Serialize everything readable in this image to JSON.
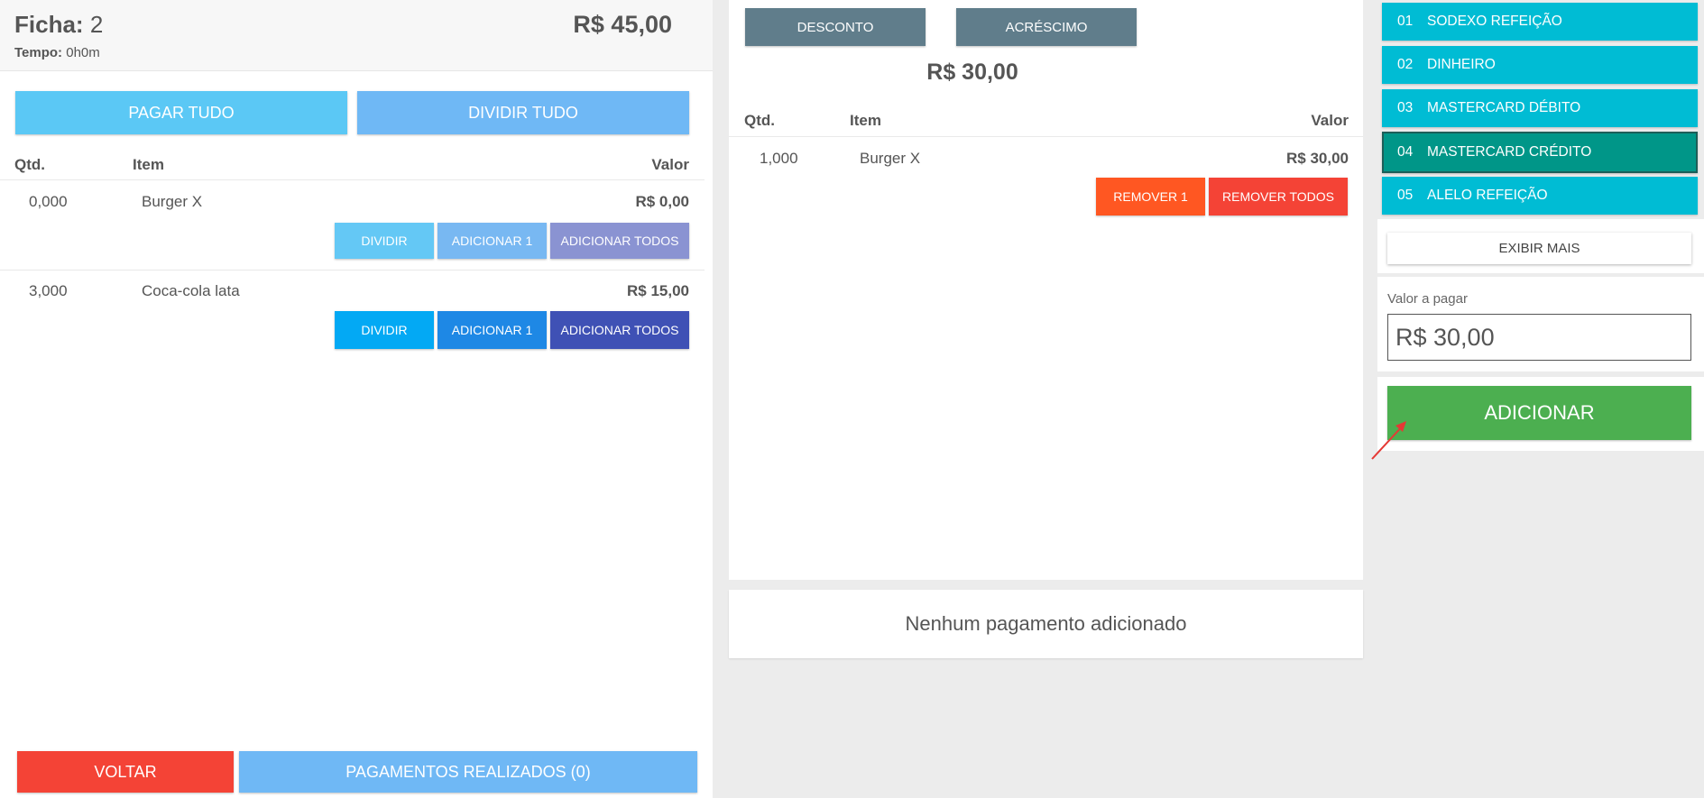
{
  "ticket": {
    "label": "Ficha:",
    "number": "2",
    "time_label": "Tempo:",
    "time_value": "0h0m",
    "total": "R$ 45,00"
  },
  "left_actions": {
    "pay_all": "PAGAR TUDO",
    "split_all": "DIVIDIR TUDO"
  },
  "left_table": {
    "headers": {
      "qty": "Qtd.",
      "item": "Item",
      "value": "Valor"
    },
    "rows": [
      {
        "qty": "0,000",
        "item": "Burger X",
        "value": "R$ 0,00",
        "btn_split": "DIVIDIR",
        "btn_add1": "ADICIONAR 1",
        "btn_addall": "ADICIONAR TODOS"
      },
      {
        "qty": "3,000",
        "item": "Coca-cola lata",
        "value": "R$ 15,00",
        "btn_split": "DIVIDIR",
        "btn_add1": "ADICIONAR 1",
        "btn_addall": "ADICIONAR TODOS"
      }
    ]
  },
  "bottom_actions": {
    "back": "VOLTAR",
    "payments_done": "PAGAMENTOS REALIZADOS (0)"
  },
  "middle": {
    "discount": "DESCONTO",
    "surcharge": "ACRÉSCIMO",
    "subtotal": "R$ 30,00",
    "headers": {
      "qty": "Qtd.",
      "item": "Item",
      "value": "Valor"
    },
    "rows": [
      {
        "qty": "1,000",
        "item": "Burger X",
        "value": "R$ 30,00",
        "btn_remove1": "REMOVER 1",
        "btn_removeall": "REMOVER TODOS"
      }
    ],
    "no_payments": "Nenhum pagamento adicionado"
  },
  "payment_methods": [
    {
      "code": "01",
      "name": "SODEXO REFEIÇÃO",
      "selected": false
    },
    {
      "code": "02",
      "name": "DINHEIRO",
      "selected": false
    },
    {
      "code": "03",
      "name": "MASTERCARD DÉBITO",
      "selected": false
    },
    {
      "code": "04",
      "name": "MASTERCARD CRÉDITO",
      "selected": true
    },
    {
      "code": "05",
      "name": "ALELO REFEIÇÃO",
      "selected": false
    }
  ],
  "show_more": "EXIBIR MAIS",
  "amount": {
    "label": "Valor a pagar",
    "value": "R$ 30,00"
  },
  "add_button": "ADICIONAR",
  "colors": {
    "cyan": "#00bcd4",
    "teal_selected": "#009688",
    "green": "#4caf50",
    "red": "#f44336",
    "deep_orange": "#ff5722",
    "blue_grey": "#607d8b",
    "annotation_arrow": "#e53935"
  }
}
